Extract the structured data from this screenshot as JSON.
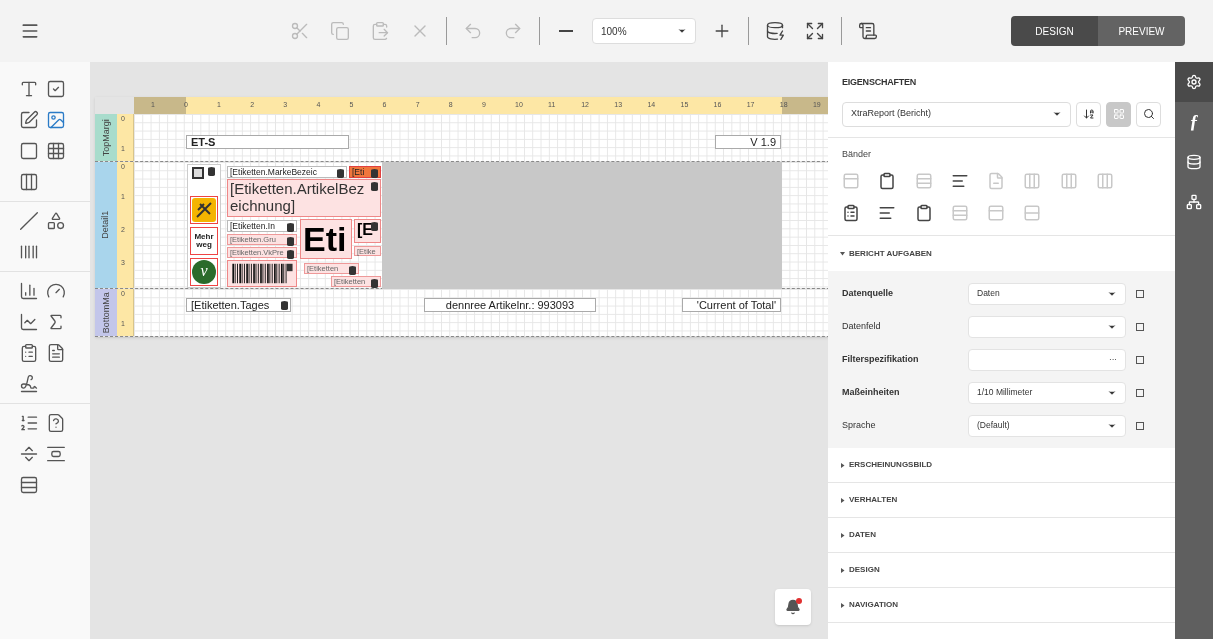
{
  "toolbar": {
    "buttons": [
      {
        "kind": "cut",
        "disabled": true
      },
      {
        "kind": "copy",
        "disabled": true
      },
      {
        "kind": "paste",
        "disabled": true
      },
      {
        "kind": "delete",
        "disabled": true
      },
      {
        "kind": "sep"
      },
      {
        "kind": "undo",
        "disabled": true
      },
      {
        "kind": "redo",
        "disabled": true
      },
      {
        "kind": "sep"
      },
      {
        "kind": "zoom-out",
        "disabled": false
      },
      {
        "kind": "zoom",
        "value": "100%"
      },
      {
        "kind": "zoom-in",
        "disabled": false
      },
      {
        "kind": "sep"
      },
      {
        "kind": "validate",
        "disabled": false
      },
      {
        "kind": "fullscreen",
        "disabled": false
      },
      {
        "kind": "sep"
      },
      {
        "kind": "scripts",
        "disabled": false
      }
    ]
  },
  "mode_tabs": [
    {
      "label": "DESIGN",
      "selected": true
    },
    {
      "label": "PREVIEW",
      "selected": false
    }
  ],
  "toolbox": [
    [
      {
        "kind": "label",
        "selected": false
      },
      {
        "kind": "checkbox",
        "selected": false
      },
      {
        "kind": "richtext",
        "selected": false
      },
      {
        "kind": "picture",
        "selected": true
      },
      {
        "kind": "panel",
        "selected": false
      },
      {
        "kind": "table",
        "selected": false
      },
      {
        "kind": "charcomb",
        "selected": false
      }
    ],
    [
      {
        "kind": "line",
        "selected": false
      },
      {
        "kind": "shape",
        "selected": false
      },
      {
        "kind": "barcode",
        "selected": false
      }
    ],
    [
      {
        "kind": "chart",
        "selected": false
      },
      {
        "kind": "gauge",
        "selected": false
      },
      {
        "kind": "sparkline",
        "selected": false
      },
      {
        "kind": "summary",
        "selected": false
      },
      {
        "kind": "subreport",
        "selected": false
      },
      {
        "kind": "pdf",
        "selected": false
      },
      {
        "kind": "signature",
        "selected": false
      }
    ],
    [
      {
        "kind": "toc",
        "selected": false
      },
      {
        "kind": "pageinfo",
        "selected": false
      },
      {
        "kind": "pagebreak",
        "selected": false
      },
      {
        "kind": "crossband-line",
        "selected": false
      },
      {
        "kind": "crossband-box",
        "selected": false
      }
    ]
  ],
  "ruler": [
    "1",
    "0",
    "1",
    "2",
    "3",
    "4",
    "5",
    "6",
    "7",
    "8",
    "9",
    "10",
    "11",
    "12",
    "13",
    "14",
    "15",
    "16",
    "17",
    "18",
    "19"
  ],
  "bands": [
    {
      "name": "TopMargi",
      "color": "#a8dccc",
      "ruler": [
        "0",
        "1"
      ],
      "kind": "margin",
      "elements": [
        {
          "text": "ET-S",
          "bold": true
        },
        {
          "text": "V 1.9",
          "bold": false
        }
      ]
    },
    {
      "name": "Detail1",
      "color": "#a9d5ec",
      "ruler": [
        "0",
        "1",
        "2",
        "3"
      ],
      "kind": "detail",
      "pictures": [
        {
          "kind": "placeholder",
          "bound": true
        },
        {
          "kind": "warning",
          "bound": false
        },
        {
          "kind": "reusable",
          "text": "Mehr weg",
          "bound": false
        },
        {
          "kind": "vegan",
          "text": "v",
          "bound": false
        }
      ],
      "fields": [
        {
          "kind": "field",
          "text": "[Etiketten.MarkeBezeic",
          "bound": true
        },
        {
          "kind": "tag",
          "text": "[Eti",
          "bound": true
        },
        {
          "kind": "title",
          "text": "[Etiketten.ArtikelBezeichnung]",
          "bound": true
        },
        {
          "kind": "field",
          "text": "[Etiketten.In",
          "bound": true
        },
        {
          "kind": "small",
          "text": "[Etiketten.Gru",
          "bound": true
        },
        {
          "kind": "small",
          "text": "[Etiketten.VkPre",
          "bound": true
        },
        {
          "kind": "big",
          "text": "Eti",
          "bound": false
        },
        {
          "kind": "medium",
          "text": "[E",
          "bound": true
        },
        {
          "kind": "small",
          "text": "[Etike",
          "bound": false
        },
        {
          "kind": "barcode",
          "bound": true
        },
        {
          "kind": "small",
          "text": "[Etiketten",
          "bound": true
        },
        {
          "kind": "small",
          "text": "[Etiketten",
          "bound": true
        }
      ]
    },
    {
      "name": "BottomMa",
      "color": "#c3c6ea",
      "ruler": [
        "0",
        "1"
      ],
      "kind": "margin",
      "elements": [
        {
          "text": "[Etiketten.Tages",
          "bold": false,
          "bound": true
        },
        {
          "text": "dennree Artikelnr.: 993093",
          "bold": false
        },
        {
          "text": "'Current of Total'",
          "bold": false
        }
      ]
    }
  ],
  "properties": {
    "title": "EIGENSCHAFTEN",
    "object": "XtraReport (Bericht)",
    "view_buttons": [
      {
        "kind": "sort",
        "selected": false
      },
      {
        "kind": "categories",
        "selected": true
      },
      {
        "kind": "search",
        "selected": false
      }
    ],
    "bands_label": "Bänder",
    "band_icons": [
      {
        "disabled": true
      },
      {
        "disabled": false
      },
      {
        "disabled": true
      },
      {
        "disabled": false
      },
      {
        "disabled": true
      },
      {
        "disabled": true
      },
      {
        "disabled": true
      },
      {
        "disabled": true
      },
      {
        "disabled": false
      },
      {
        "disabled": false
      },
      {
        "disabled": false
      },
      {
        "disabled": true
      },
      {
        "disabled": true
      },
      {
        "disabled": true
      }
    ],
    "tasks": {
      "title": "BERICHT AUFGABEN",
      "expanded": true,
      "rows": [
        {
          "label": "Datenquelle",
          "modified": true,
          "kind": "dropdown",
          "value": "Daten",
          "checked": false
        },
        {
          "label": "Datenfeld",
          "modified": false,
          "kind": "dropdown",
          "checked": false
        },
        {
          "label": "Filterspezifikation",
          "modified": true,
          "kind": "editor",
          "button": "···",
          "checked": false
        },
        {
          "label": "Maßeinheiten",
          "modified": true,
          "kind": "dropdown",
          "value": "1/10 Millimeter",
          "checked": false
        },
        {
          "label": "Sprache",
          "modified": false,
          "kind": "dropdown",
          "value": "(Default)",
          "checked": false
        }
      ]
    },
    "sections": [
      {
        "title": "ERSCHEINUNGSBILD",
        "expanded": false
      },
      {
        "title": "VERHALTEN",
        "expanded": false
      },
      {
        "title": "DATEN",
        "expanded": false
      },
      {
        "title": "DESIGN",
        "expanded": false
      },
      {
        "title": "NAVIGATION",
        "expanded": false
      }
    ]
  },
  "side_tabs": [
    {
      "kind": "properties",
      "selected": true
    },
    {
      "kind": "expressions",
      "symbol": "ƒ",
      "selected": false
    },
    {
      "kind": "fieldlist",
      "selected": false
    },
    {
      "kind": "explorer",
      "selected": false
    }
  ],
  "notification": {
    "unread": true
  }
}
